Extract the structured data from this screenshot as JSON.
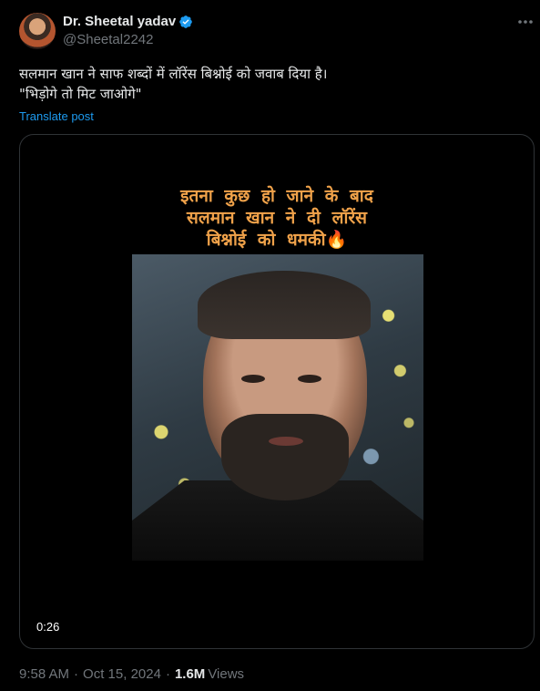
{
  "author": {
    "name": "Dr. Sheetal yadav",
    "handle": "@Sheetal2242",
    "verified_color": "#1d9bf0"
  },
  "post": {
    "line1": "सलमान खान ने साफ शब्दों में लॉरेंस बिश्नोई को जवाब दिया है।",
    "line2": "\"भिड़ोगे तो मिट जाओगे\"",
    "translate_label": "Translate post"
  },
  "video": {
    "overlay_line1": "इतना कुछ हो जाने के बाद",
    "overlay_line2": "सलमान खान ने दी लॉरेंस",
    "overlay_line3": "बिश्नोई को धमकी🔥",
    "duration": "0:26"
  },
  "meta": {
    "time": "9:58 AM",
    "date": "Oct 15, 2024",
    "views_count": "1.6M",
    "views_label": "Views"
  },
  "icons": {
    "verified": "verified-badge-icon",
    "more": "more-options-icon"
  }
}
